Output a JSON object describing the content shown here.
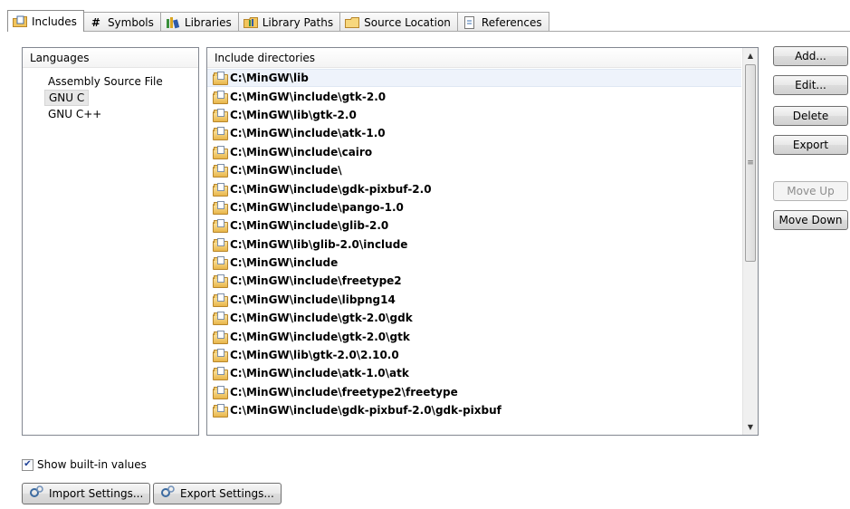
{
  "tabs": [
    {
      "label": "Includes",
      "icon": "includes-icon"
    },
    {
      "label": "Symbols",
      "icon": "hash-icon"
    },
    {
      "label": "Libraries",
      "icon": "libraries-icon"
    },
    {
      "label": "Library Paths",
      "icon": "library-paths-icon"
    },
    {
      "label": "Source Location",
      "icon": "folder-icon"
    },
    {
      "label": "References",
      "icon": "references-icon"
    }
  ],
  "languages": {
    "header": "Languages",
    "items": [
      "Assembly Source File",
      "GNU C",
      "GNU C++"
    ],
    "selected": "GNU C"
  },
  "directories": {
    "header": "Include directories",
    "items": [
      "C:\\MinGW\\lib",
      "C:\\MinGW\\include\\gtk-2.0",
      "C:\\MinGW\\lib\\gtk-2.0",
      "C:\\MinGW\\include\\atk-1.0",
      "C:\\MinGW\\include\\cairo",
      "C:\\MinGW\\include\\",
      "C:\\MinGW\\include\\gdk-pixbuf-2.0",
      "C:\\MinGW\\include\\pango-1.0",
      "C:\\MinGW\\include\\glib-2.0",
      "C:\\MinGW\\lib\\glib-2.0\\include",
      "C:\\MinGW\\include",
      "C:\\MinGW\\include\\freetype2",
      "C:\\MinGW\\include\\libpng14",
      "C:\\MinGW\\include\\gtk-2.0\\gdk",
      "C:\\MinGW\\include\\gtk-2.0\\gtk",
      "C:\\MinGW\\lib\\gtk-2.0\\2.10.0",
      "C:\\MinGW\\include\\atk-1.0\\atk",
      "C:\\MinGW\\include\\freetype2\\freetype",
      "C:\\MinGW\\include\\gdk-pixbuf-2.0\\gdk-pixbuf"
    ]
  },
  "buttons": {
    "add": "Add...",
    "edit": "Edit...",
    "delete": "Delete",
    "export": "Export",
    "move_up": "Move Up",
    "move_down": "Move Down"
  },
  "show_builtin": {
    "label": "Show built-in values",
    "checked": true
  },
  "import_settings": "Import Settings...",
  "export_settings": "Export Settings..."
}
